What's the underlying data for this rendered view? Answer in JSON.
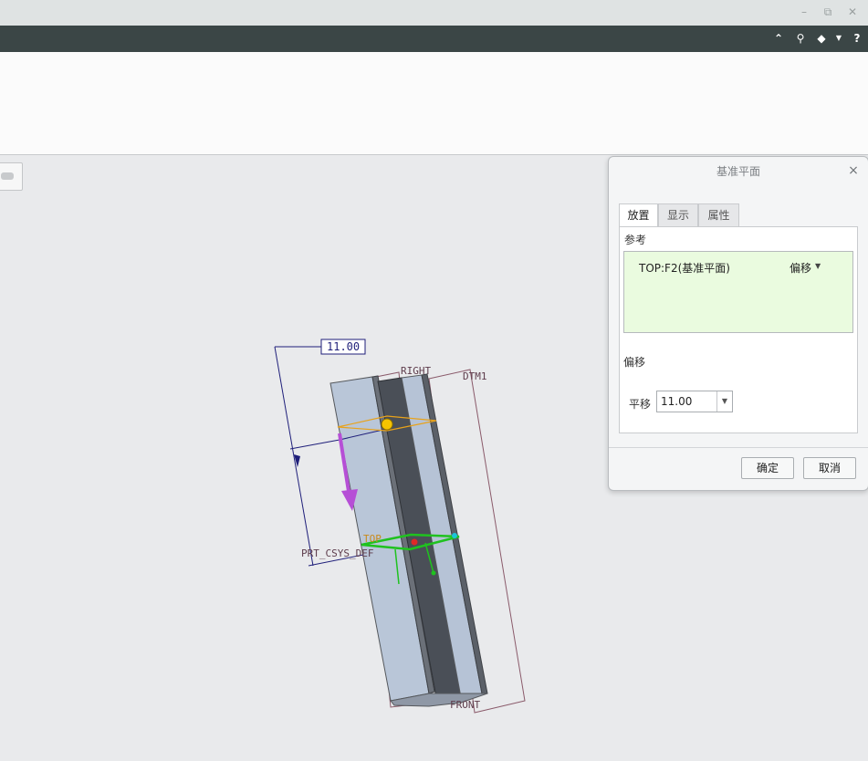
{
  "window": {
    "minimize_icon": "minimize-icon",
    "restore_icon": "restore-icon",
    "close_icon": "close-icon"
  },
  "toolbar": {
    "icons": [
      "caret-up-icon",
      "search-icon",
      "graduation-cap-icon",
      "dropdown-caret-icon",
      "help-icon"
    ]
  },
  "model": {
    "dimension_value": "11.00",
    "labels": {
      "right": "RIGHT",
      "dtm": "DTM1",
      "top": "TOP",
      "csys": "PRT_CSYS_DEF",
      "front": "FRONT"
    }
  },
  "dialog": {
    "title": "基准平面",
    "tabs": [
      "放置",
      "显示",
      "属性"
    ],
    "active_tab": "放置",
    "references_label": "参考",
    "reference_item": "TOP:F2(基准平面)",
    "reference_mode": "偏移",
    "offset_section_label": "偏移",
    "translation_label": "平移",
    "translation_value": "11.00",
    "ok_label": "确定",
    "cancel_label": "取消",
    "colors": {
      "reference_bg": "#eafbdf"
    }
  }
}
